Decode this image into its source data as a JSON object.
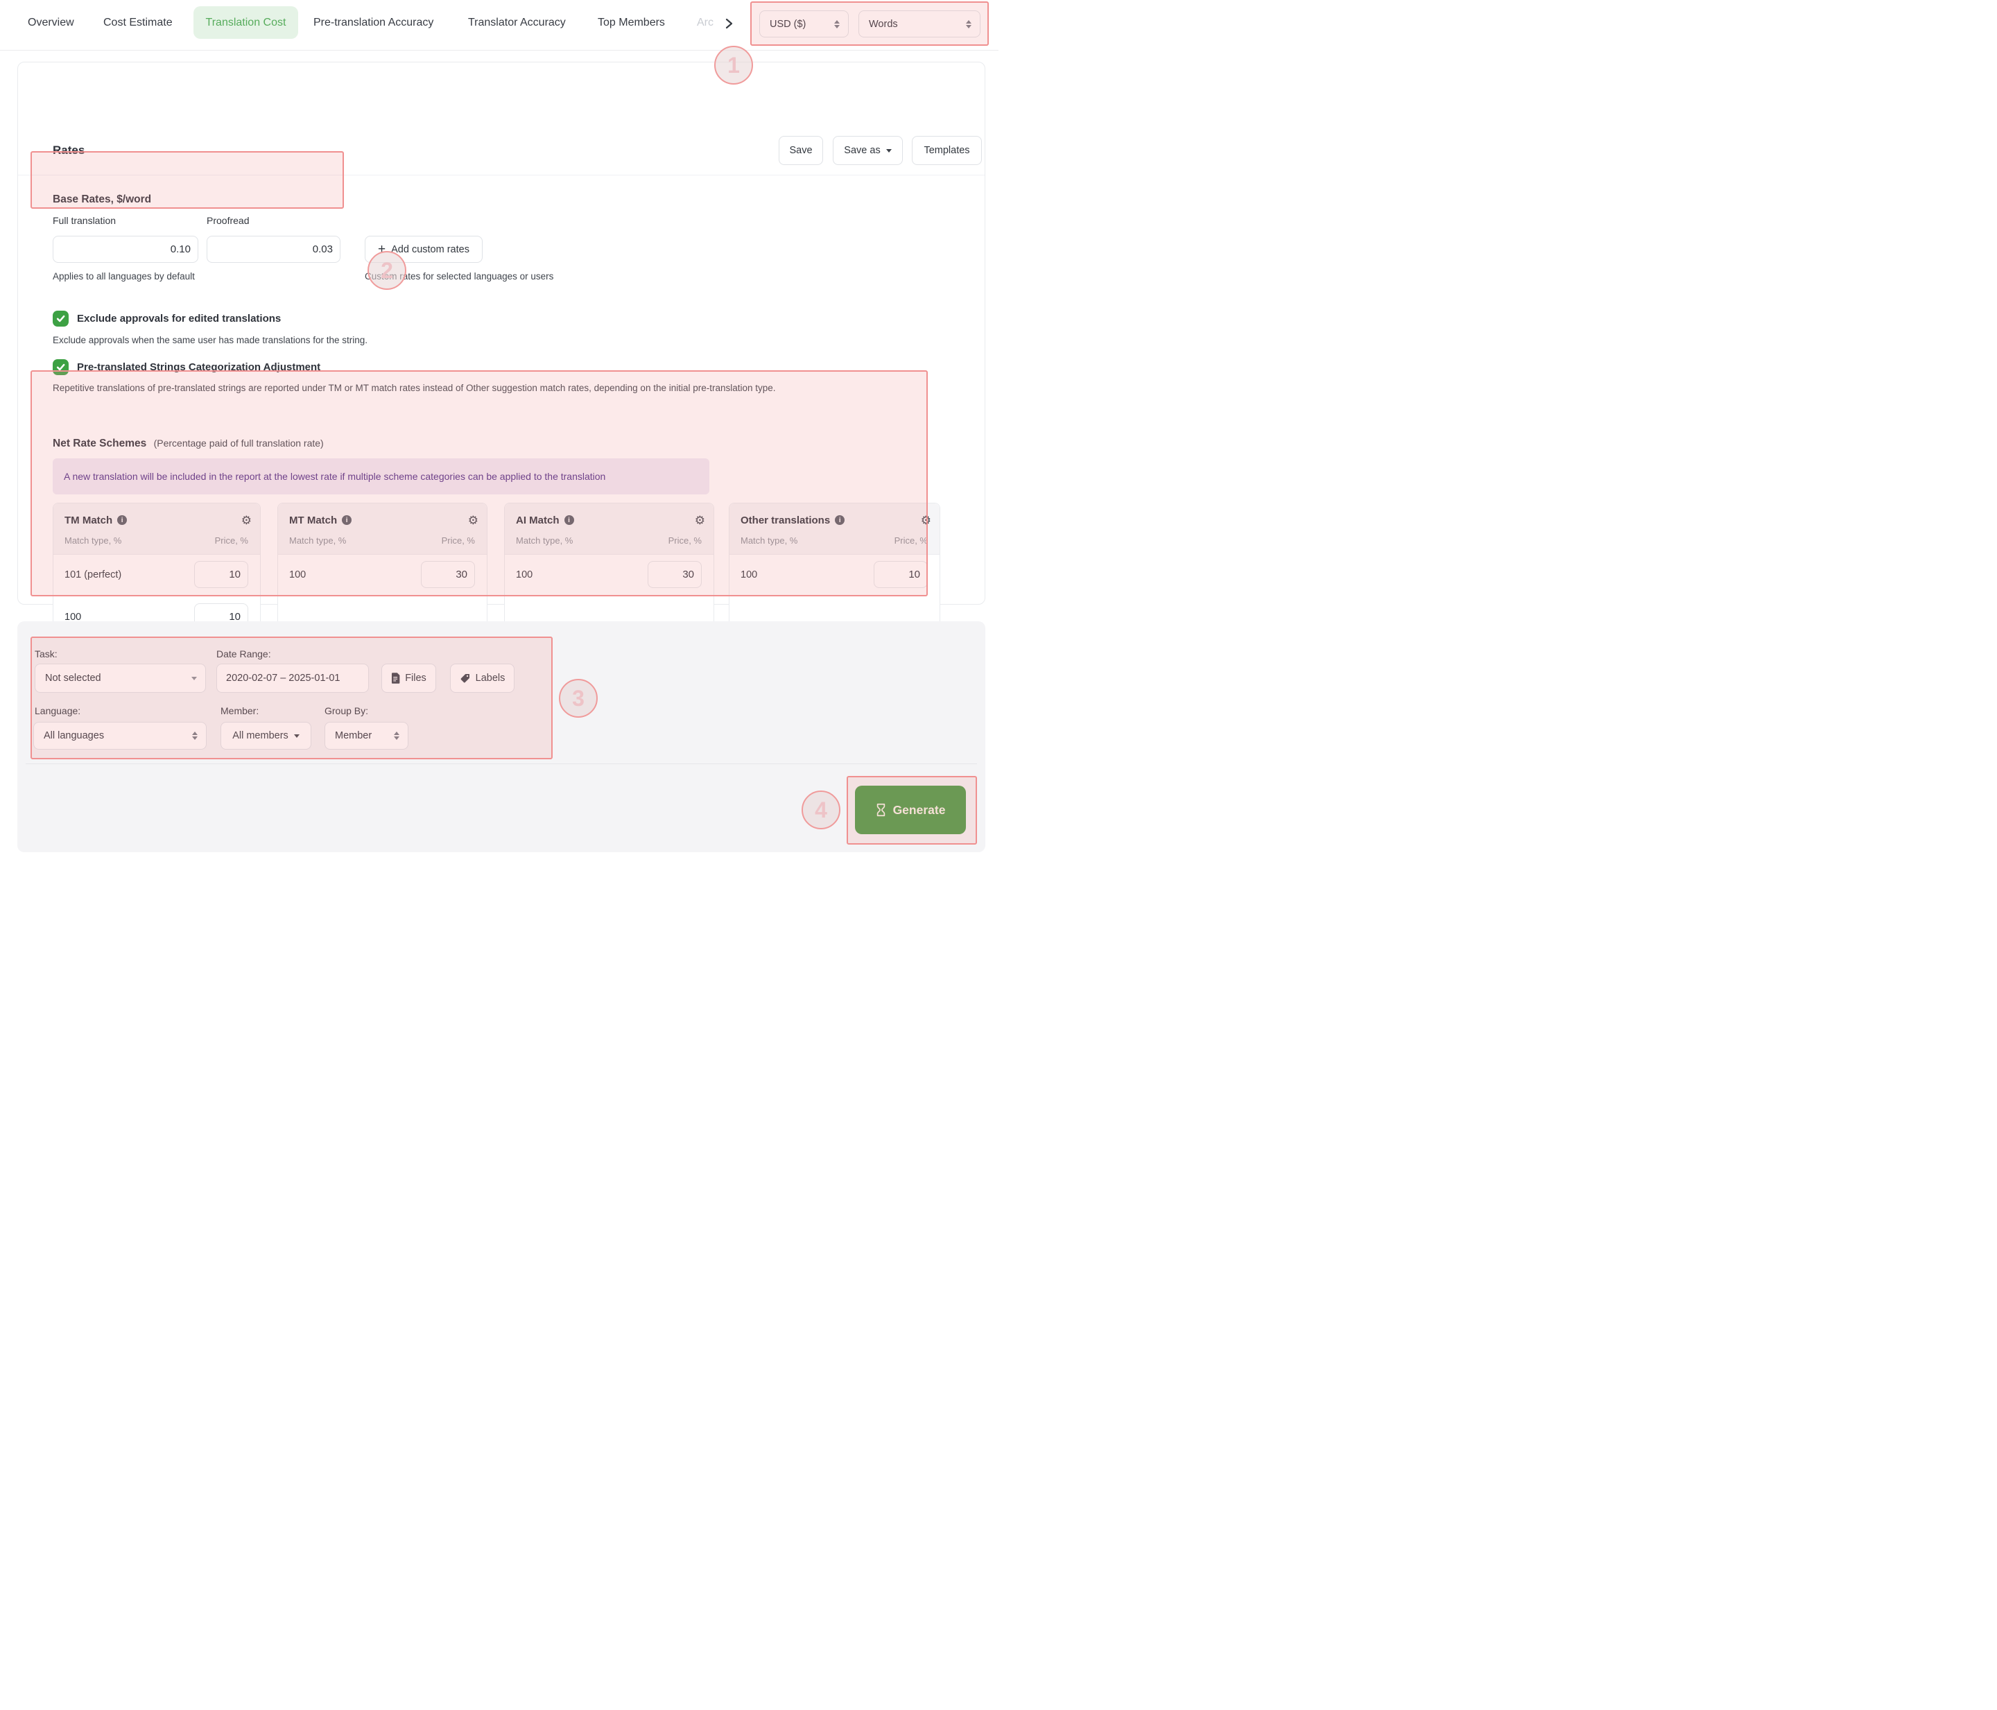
{
  "tabs": {
    "items": [
      {
        "label": "Overview"
      },
      {
        "label": "Cost Estimate"
      },
      {
        "label": "Translation Cost"
      },
      {
        "label": "Pre-translation Accuracy"
      },
      {
        "label": "Translator Accuracy"
      },
      {
        "label": "Top Members"
      },
      {
        "label": "Arc"
      }
    ],
    "active": "Translation Cost"
  },
  "header_controls": {
    "currency": "USD ($)",
    "units": "Words"
  },
  "rates_panel": {
    "title": "Rates",
    "save_label": "Save",
    "save_as_label": "Save as",
    "templates_label": "Templates"
  },
  "base_rates": {
    "heading": "Base Rates, $/word",
    "full_translation_label": "Full translation",
    "full_translation_value": "0.10",
    "proofread_label": "Proofread",
    "proofread_value": "0.03",
    "add_custom_label": "Add custom rates",
    "default_note": "Applies to all languages by default",
    "custom_note": "Custom rates for selected languages or users"
  },
  "options": {
    "exclude_approvals": {
      "label": "Exclude approvals for edited translations",
      "description": "Exclude approvals when the same user has made translations for the string.",
      "checked": true
    },
    "pretranslated_adjustment": {
      "label": "Pre-translated Strings Categorization Adjustment",
      "description": "Repetitive translations of pre-translated strings are reported under TM or MT match rates instead of Other suggestion match rates, depending on the initial pre-translation type.",
      "checked": true
    }
  },
  "net_rate_schemes": {
    "heading": "Net Rate Schemes",
    "subheading": "(Percentage paid of full translation rate)",
    "notice": "A new translation will be included in the report at the lowest rate if multiple scheme categories can be applied to the translation",
    "match_col_label": "Match type, %",
    "price_col_label": "Price, %",
    "cards": [
      {
        "title": "TM Match",
        "rows": [
          {
            "match": "101 (perfect)",
            "price": "10"
          },
          {
            "match": "100",
            "price": "10"
          }
        ]
      },
      {
        "title": "MT Match",
        "rows": [
          {
            "match": "100",
            "price": "30"
          }
        ]
      },
      {
        "title": "AI Match",
        "rows": [
          {
            "match": "100",
            "price": "30"
          }
        ]
      },
      {
        "title": "Other translations",
        "rows": [
          {
            "match": "100",
            "price": "10"
          }
        ]
      }
    ]
  },
  "filters": {
    "task_label": "Task:",
    "task_value": "Not selected",
    "date_label": "Date Range:",
    "date_value": "2020-02-07 – 2025-01-01",
    "files_label": "Files",
    "labels_label": "Labels",
    "language_label": "Language:",
    "language_value": "All languages",
    "member_label": "Member:",
    "member_value": "All members",
    "group_by_label": "Group By:",
    "group_by_value": "Member"
  },
  "footer": {
    "generate_label": "Generate"
  },
  "annotations": {
    "badge1": "1",
    "badge2": "2",
    "badge3": "3",
    "badge4": "4"
  },
  "colors": {
    "accent_green": "#4a9a44",
    "tab_active_bg": "#e5f3e6",
    "tab_active_text": "#57ac5c",
    "annotation": "#ef9090",
    "checkbox_green": "#3da144",
    "notice_text": "#4f2d87",
    "notice_bg": "#f1eaf6"
  }
}
